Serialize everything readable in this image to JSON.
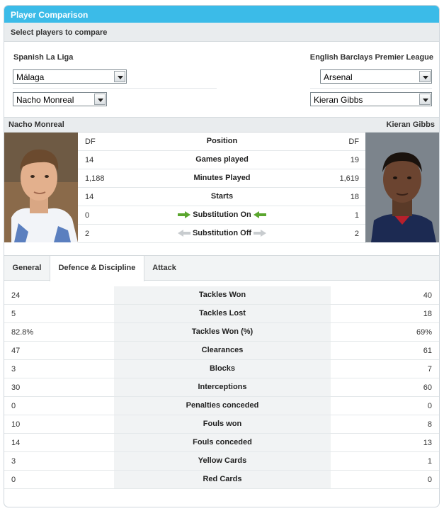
{
  "header": {
    "title": "Player Comparison"
  },
  "subheader": {
    "title": "Select players to compare"
  },
  "left": {
    "league": "Spanish La Liga",
    "club": "Málaga",
    "player": "Nacho Monreal"
  },
  "right": {
    "league": "English Barclays Premier League",
    "club": "Arsenal",
    "player": "Kieran Gibbs"
  },
  "overview": [
    {
      "label": "Position",
      "left": "DF",
      "right": "DF"
    },
    {
      "label": "Games played",
      "left": "14",
      "right": "19"
    },
    {
      "label": "Minutes Played",
      "left": "1,188",
      "right": "1,619"
    },
    {
      "label": "Starts",
      "left": "14",
      "right": "18"
    },
    {
      "label": "Substitution On",
      "left": "0",
      "right": "1"
    },
    {
      "label": "Substitution Off",
      "left": "2",
      "right": "2"
    }
  ],
  "tabs": [
    "General",
    "Defence & Discipline",
    "Attack"
  ],
  "stats": [
    {
      "label": "Tackles Won",
      "left": "24",
      "right": "40"
    },
    {
      "label": "Tackles Lost",
      "left": "5",
      "right": "18"
    },
    {
      "label": "Tackles Won (%)",
      "left": "82.8%",
      "right": "69%"
    },
    {
      "label": "Clearances",
      "left": "47",
      "right": "61"
    },
    {
      "label": "Blocks",
      "left": "3",
      "right": "7"
    },
    {
      "label": "Interceptions",
      "left": "30",
      "right": "60"
    },
    {
      "label": "Penalties conceded",
      "left": "0",
      "right": "0"
    },
    {
      "label": "Fouls won",
      "left": "10",
      "right": "8"
    },
    {
      "label": "Fouls conceded",
      "left": "14",
      "right": "13"
    },
    {
      "label": "Yellow Cards",
      "left": "3",
      "right": "1"
    },
    {
      "label": "Red Cards",
      "left": "0",
      "right": "0"
    }
  ],
  "colors": {
    "header": "#3bbbe8",
    "arrow_on": "#5aa62e",
    "arrow_off": "#c8cccf"
  }
}
